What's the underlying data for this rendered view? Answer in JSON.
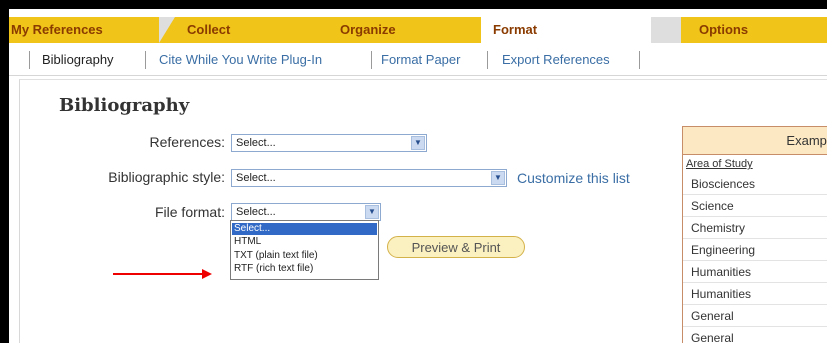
{
  "tabs": [
    {
      "label": "My References"
    },
    {
      "label": "Collect"
    },
    {
      "label": "Organize"
    },
    {
      "label": "Format"
    },
    {
      "label": "Options"
    }
  ],
  "subnav": [
    {
      "label": "Bibliography"
    },
    {
      "label": "Cite While You Write Plug-In"
    },
    {
      "label": "Format Paper"
    },
    {
      "label": "Export References"
    }
  ],
  "page": {
    "title": "Bibliography"
  },
  "form": {
    "references_label": "References:",
    "references_value": "Select...",
    "style_label": "Bibliographic style:",
    "style_value": "Select...",
    "customize_link": "Customize this list",
    "file_label": "File format:",
    "file_value": "Select...",
    "file_options": [
      "Select...",
      "HTML",
      "TXT (plain text file)",
      "RTF (rich text file)"
    ],
    "preview_button": "Preview & Print"
  },
  "examples": {
    "header": "Example",
    "area_label": "Area of Study",
    "rows": [
      "Biosciences",
      "Science",
      "Chemistry",
      "Engineering",
      "Humanities",
      "Humanities",
      "General",
      "General"
    ]
  },
  "colors": {
    "tab_bar": "#f0c419",
    "link": "#3a6ea5",
    "annotation_arrow": "#e00000"
  }
}
